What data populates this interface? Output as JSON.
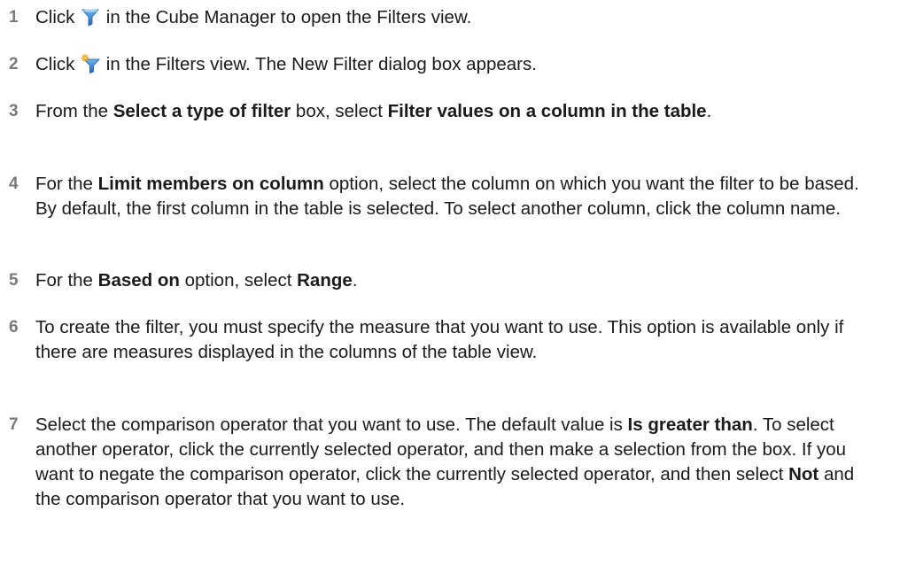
{
  "steps": [
    {
      "number": "1",
      "parts": {
        "a": "Click ",
        "icon": "filter-funnel-icon",
        "b": " in the Cube Manager to open the Filters view."
      }
    },
    {
      "number": "2",
      "parts": {
        "a": "Click ",
        "icon": "new-filter-funnel-icon",
        "b": " in the Filters view. The New Filter dialog box appears."
      }
    },
    {
      "number": "3",
      "parts": {
        "a": "From the ",
        "b1": "Select a type of filter",
        "c": " box, select ",
        "b2": "Filter values on a column in the table",
        "d": "."
      }
    },
    {
      "number": "4",
      "parts": {
        "a": "For the ",
        "b1": "Limit members on column",
        "c": " option, select the column on which you want the filter to be based. By default, the first column in the table is selected. To select another column, click the column name."
      }
    },
    {
      "number": "5",
      "parts": {
        "a": "For the ",
        "b1": "Based on",
        "c": " option, select ",
        "b2": "Range",
        "d": "."
      }
    },
    {
      "number": "6",
      "parts": {
        "a": "To create the filter, you must specify the measure that you want to use. This option is available only if there are measures displayed in the columns of the table view."
      }
    },
    {
      "number": "7",
      "parts": {
        "a": "Select the comparison operator that you want to use. The default value is ",
        "b1": "Is greater than",
        "c": ". To select another operator, click the currently selected operator, and then make a selection from the box. If you want to negate the comparison operator, click the currently selected operator, and then select ",
        "b2": "Not",
        "d": " and the comparison operator that you want to use."
      }
    }
  ],
  "colors": {
    "text": "#1a1a1a",
    "step_number": "#7a7a7a",
    "funnel_blue": "#2f7fd0",
    "new_star_orange": "#f0a020"
  }
}
